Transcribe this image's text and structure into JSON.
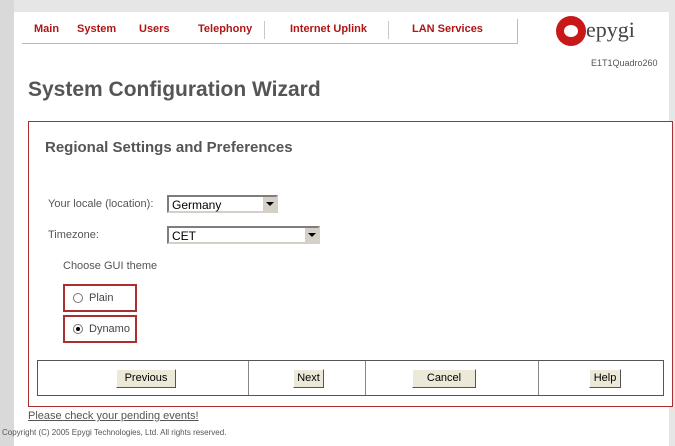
{
  "nav": {
    "items": [
      "Main",
      "System",
      "Users",
      "Telephony",
      "Internet Uplink",
      "LAN Services"
    ]
  },
  "logo": {
    "text": "epygi",
    "model": "E1T1Quadro260"
  },
  "page_title": "System Configuration Wizard",
  "section_title": "Regional Settings and Preferences",
  "locale": {
    "label": "Your locale (location):",
    "value": "Germany"
  },
  "timezone": {
    "label": "Timezone:",
    "value": "CET"
  },
  "theme": {
    "label": "Choose GUI theme",
    "options": [
      {
        "label": "Plain",
        "selected": false
      },
      {
        "label": "Dynamo",
        "selected": true
      }
    ]
  },
  "buttons": {
    "previous": "Previous",
    "next": "Next",
    "cancel": "Cancel",
    "help": "Help"
  },
  "footer": {
    "pending_link": "Please check your pending events!",
    "copyright": "Copyright (C) 2005 Epygi Technologies, Ltd. All rights reserved."
  },
  "colors": {
    "nav_text": "#b01515",
    "accent_border": "#a83030",
    "logo_red": "#c81818"
  }
}
